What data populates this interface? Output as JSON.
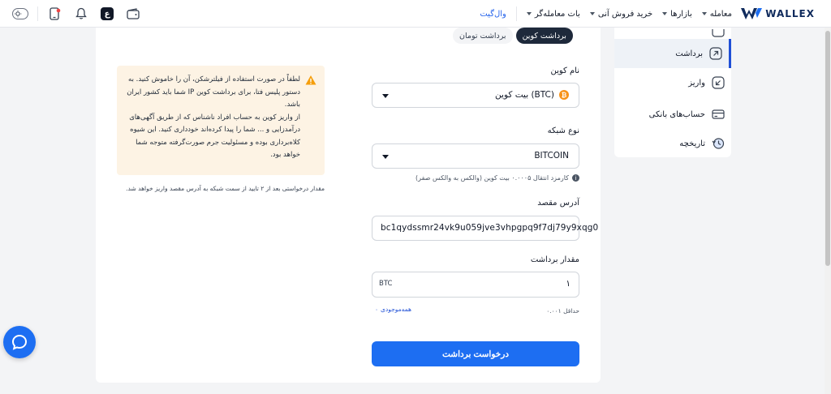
{
  "header": {
    "logo_text": "WALLEX",
    "nav": [
      {
        "label": "معامله",
        "dropdown": true
      },
      {
        "label": "بازارها",
        "dropdown": true
      },
      {
        "label": "خرید فروش آنی",
        "dropdown": true
      },
      {
        "label": "بات معامله‌گر",
        "dropdown": true
      },
      {
        "label": "وال‌گیت",
        "dropdown": false
      }
    ],
    "currency_badge": "ع"
  },
  "sidebar": {
    "items": [
      {
        "label": "برداشت",
        "icon": "arrow-up-right-icon",
        "active": true
      },
      {
        "label": "واریز",
        "icon": "arrow-down-left-icon",
        "active": false
      },
      {
        "label": "حساب‌های بانکی",
        "icon": "card-icon",
        "active": false
      },
      {
        "label": "تاریخچه",
        "icon": "history-icon",
        "active": false
      }
    ]
  },
  "tabs": {
    "coin": "برداشت کوین",
    "toman": "برداشت تومان"
  },
  "form": {
    "coin_label": "نام کوین",
    "coin_value": "بیت کوین (BTC)",
    "coin_symbol": "₿",
    "network_label": "نوع شبکه",
    "network_value": "BITCOIN",
    "fee_note": "کارمزد انتقال ۰.۰۰۰۵ بیت کوین (والکس به والکس صفر)",
    "address_label": "آدرس مقصد",
    "address_value": "bc1qydssmr24vk9u059jve3vhpgpq9f7dj79y9xqg0",
    "amount_label": "مقدار برداشت",
    "amount_value": "۱",
    "amount_unit": "BTC",
    "min_text": "حداقل ۰.۰۰۱",
    "all_balance_label": "همه‌موجودی",
    "all_balance_value": "۰",
    "submit_label": "درخواست برداشت"
  },
  "warning": {
    "line1": "لطفاً در صورت استفاده از فیلترشکن، آن را خاموش کنید. به دستور پلیس فتا، برای برداشت کوین IP شما باید کشور ایران باشد.",
    "line2": "از واریز کوین به حساب افراد ناشناس که از طریق آگهی‌های درآمدزایی و ... شما را پیدا کرده‌اند خودداری کنید. این شیوه کلاه‌برداری بوده و مسئولیت جرم صورت‌گرفته متوجه شما خواهد بود."
  },
  "after_note": "مقدار درخواستی بعد از ۲ تایید از سمت شبکه به آدرس مقصد واریز خواهد شد.",
  "colors": {
    "primary": "#1d6ef2",
    "brand_dark": "#0f2a5c",
    "warning_bg": "#fdf3e4",
    "warning_icon": "#f59e0b",
    "btc": "#f7931a"
  }
}
